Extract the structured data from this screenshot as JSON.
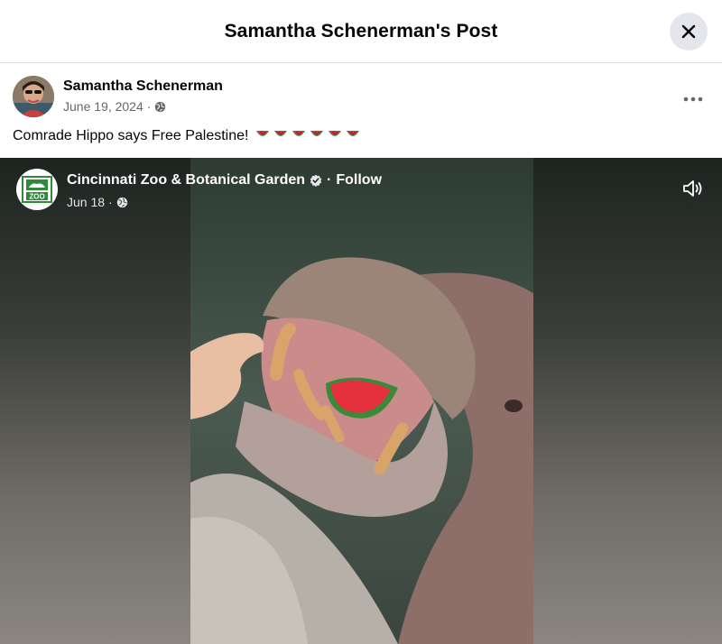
{
  "dialog": {
    "title": "Samantha Schenerman's Post"
  },
  "post": {
    "author": "Samantha Schenerman",
    "date": "June 19, 2024",
    "separator": "·",
    "text": "Comrade Hippo says Free Palestine!",
    "emoji_count": 6,
    "emoji_icon": "watermelon-icon"
  },
  "shared": {
    "page_name": "Cincinnati Zoo & Botanical Garden",
    "follow_label": "Follow",
    "separator": "·",
    "date": "Jun 18",
    "logo_text": "ZOO"
  },
  "icons": {
    "close": "close-icon",
    "more": "more-options-icon",
    "privacy": "globe-icon",
    "verified": "verified-badge-icon",
    "sound": "speaker-icon"
  },
  "colors": {
    "secondary_text": "#65676b",
    "button_gray": "#e4e6eb",
    "watermelon_red": "#e3303c",
    "watermelon_green": "#3b8a3a"
  }
}
